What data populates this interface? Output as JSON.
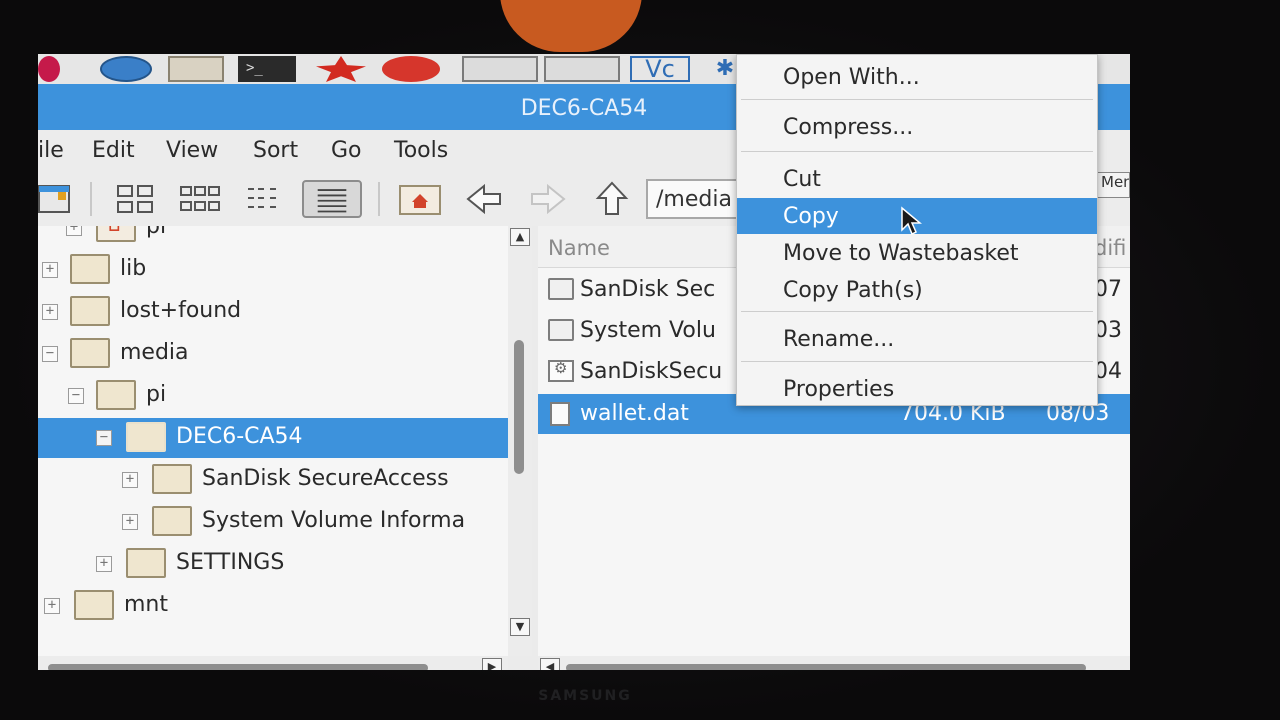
{
  "window": {
    "title": "DEC6-CA54"
  },
  "taskbar": {
    "terminal_glyph": ">_",
    "vnc_label": "Vc",
    "bluetooth_glyph": "✱"
  },
  "menubar": {
    "items": [
      "ile",
      "Edit",
      "View",
      "Sort",
      "Go",
      "Tools"
    ]
  },
  "toolbar": {
    "path": "/media",
    "right_button": "Men"
  },
  "tree": {
    "items": [
      {
        "label": "pi",
        "expander": "+"
      },
      {
        "label": "lib",
        "expander": "+"
      },
      {
        "label": "lost+found",
        "expander": "+"
      },
      {
        "label": "media",
        "expander": "−"
      },
      {
        "label": "pi",
        "expander": "−"
      },
      {
        "label": "DEC6-CA54",
        "expander": "−"
      },
      {
        "label": "SanDisk SecureAccess",
        "expander": "+"
      },
      {
        "label": "System Volume Informa",
        "expander": "+"
      },
      {
        "label": "SETTINGS",
        "expander": "+"
      },
      {
        "label": "mnt",
        "expander": "+"
      }
    ]
  },
  "file_list": {
    "columns": {
      "name": "Name",
      "modified": "difi"
    },
    "rows": [
      {
        "name": "SanDisk Sec",
        "size": "",
        "modified": "07"
      },
      {
        "name": "System Volu",
        "size": "",
        "modified": "03"
      },
      {
        "name": "SanDiskSecu",
        "size": "",
        "modified": "04"
      },
      {
        "name": "wallet.dat",
        "size": "704.0 KiB",
        "modified": "08/03"
      }
    ]
  },
  "context_menu": {
    "items": [
      "Open With...",
      "Compress...",
      "Cut",
      "Copy",
      "Move to Wastebasket",
      "Copy Path(s)",
      "Rename...",
      "Properties"
    ],
    "highlighted": "Copy"
  },
  "monitor": {
    "brand": "SAMSUNG"
  },
  "colors": {
    "accent": "#3d92dc",
    "background": "#ebebeb"
  }
}
